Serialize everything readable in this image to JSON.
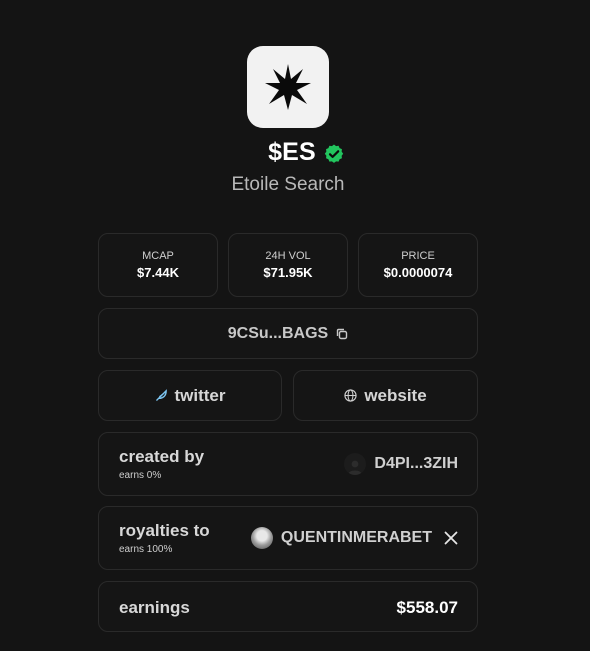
{
  "token": {
    "symbol": "$ES",
    "name": "Etoile Search",
    "verified_color": "#22c55e",
    "logo_icon": "star-burst-icon"
  },
  "stats": [
    {
      "label": "MCAP",
      "value": "$7.44K"
    },
    {
      "label": "24H VOL",
      "value": "$71.95K"
    },
    {
      "label": "PRICE",
      "value": "$0.0000074"
    }
  ],
  "contract": {
    "address": "9CSu...BAGS",
    "icon": "copy-icon"
  },
  "links": {
    "twitter": {
      "label": "twitter",
      "icon": "feather-icon"
    },
    "website": {
      "label": "website",
      "icon": "globe-icon"
    }
  },
  "creator": {
    "label": "created by",
    "earns": "earns 0%",
    "handle": "D4PI...3ZIH"
  },
  "royalties": {
    "label": "royalties to",
    "earns": "earns 100%",
    "handle": "QUENTINMERABET",
    "icon": "x-logo-icon"
  },
  "earnings": {
    "label": "earnings",
    "value": "$558.07"
  }
}
